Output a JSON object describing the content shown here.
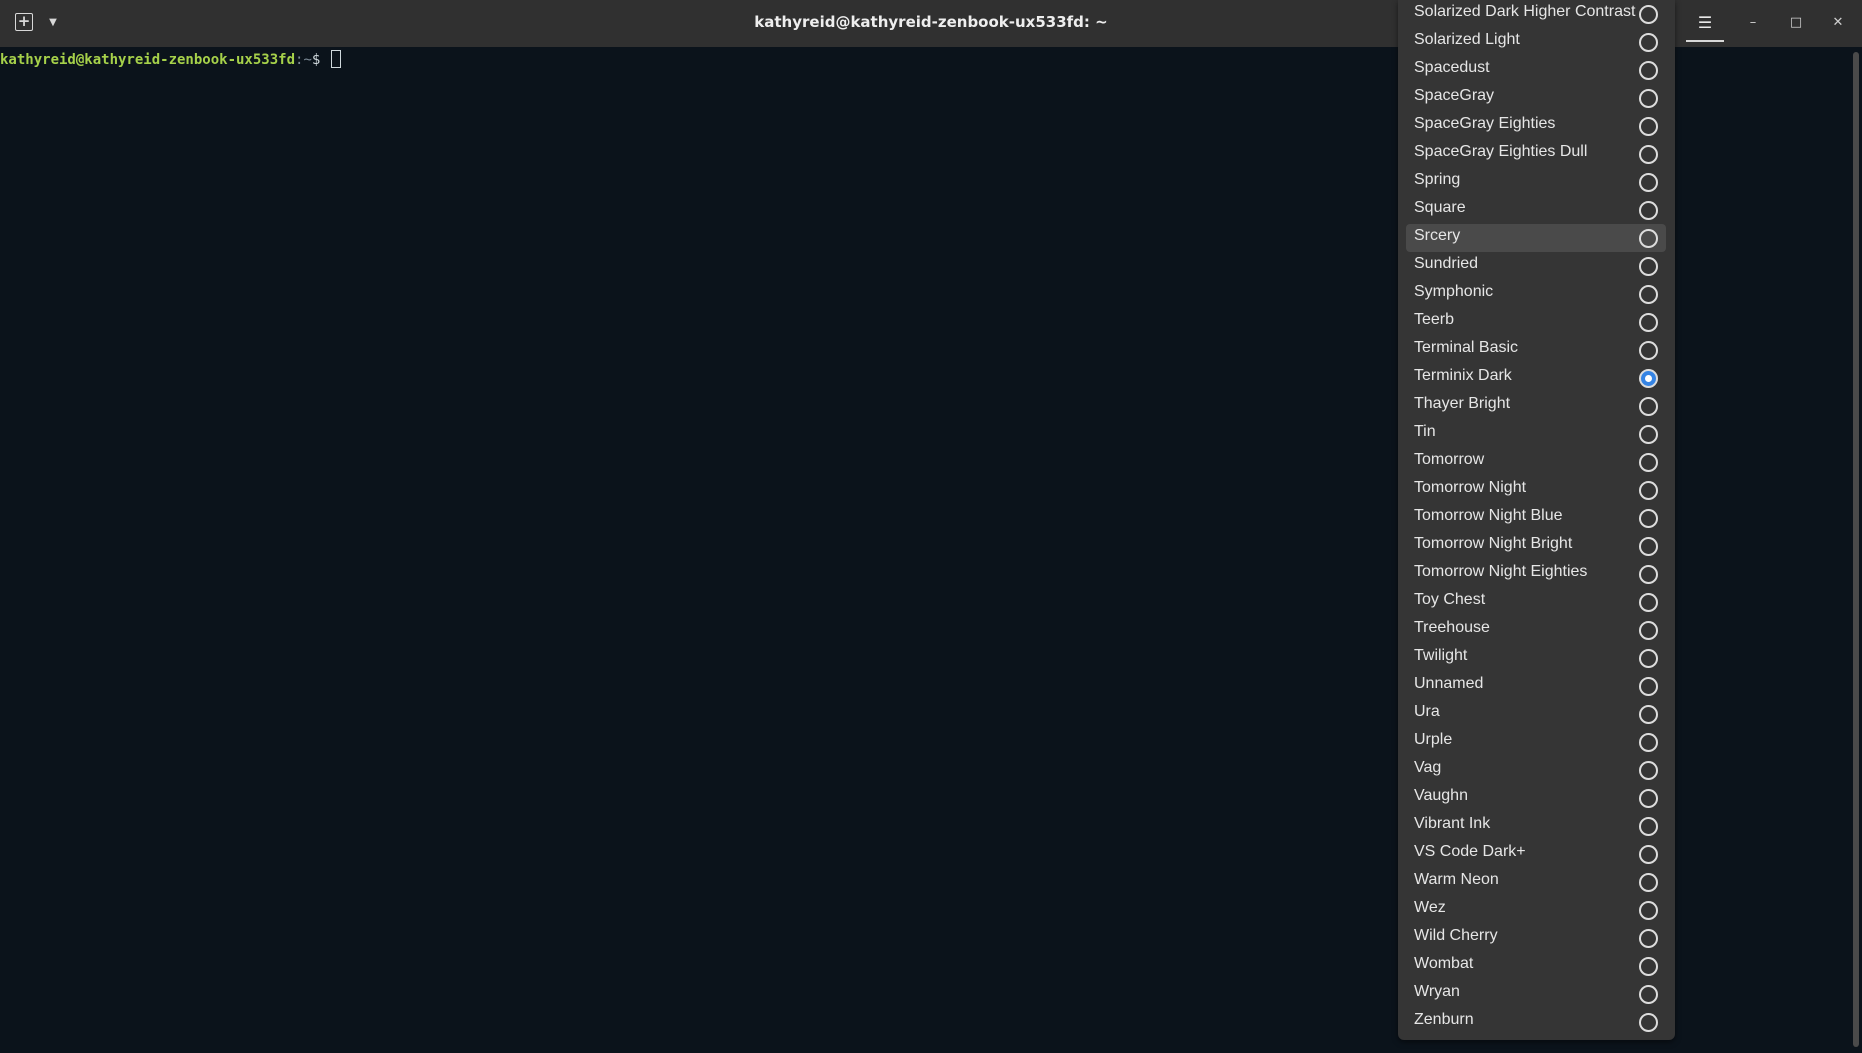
{
  "window": {
    "title": "kathyreid@kathyreid-zenbook-ux533fd: ~",
    "icons": {
      "new_tab": "new-tab-icon",
      "dropdown": "chevron-down-icon",
      "menu": "hamburger-menu-icon",
      "minimize": "minimize-icon",
      "maximize": "maximize-icon",
      "close": "close-icon"
    }
  },
  "terminal": {
    "prompt_user": "kathyreid@kathyreid-zenbook-ux533fd",
    "prompt_sep": ":~",
    "prompt_dollar": "$",
    "colors": {
      "background": "#0b131b",
      "user": "#a6d14a"
    }
  },
  "theme_menu": {
    "selected": "Terminix Dark",
    "hovered": "Srcery",
    "accent": "#3584e4",
    "items": [
      "Solarized Dark Higher Contrast",
      "Solarized Light",
      "Spacedust",
      "SpaceGray",
      "SpaceGray Eighties",
      "SpaceGray Eighties Dull",
      "Spring",
      "Square",
      "Srcery",
      "Sundried",
      "Symphonic",
      "Teerb",
      "Terminal Basic",
      "Terminix Dark",
      "Thayer Bright",
      "Tin",
      "Tomorrow",
      "Tomorrow Night",
      "Tomorrow Night Blue",
      "Tomorrow Night Bright",
      "Tomorrow Night Eighties",
      "Toy Chest",
      "Treehouse",
      "Twilight",
      "Unnamed",
      "Ura",
      "Urple",
      "Vag",
      "Vaughn",
      "Vibrant Ink",
      "VS Code Dark+",
      "Warm Neon",
      "Wez",
      "Wild Cherry",
      "Wombat",
      "Wryan",
      "Zenburn"
    ]
  }
}
